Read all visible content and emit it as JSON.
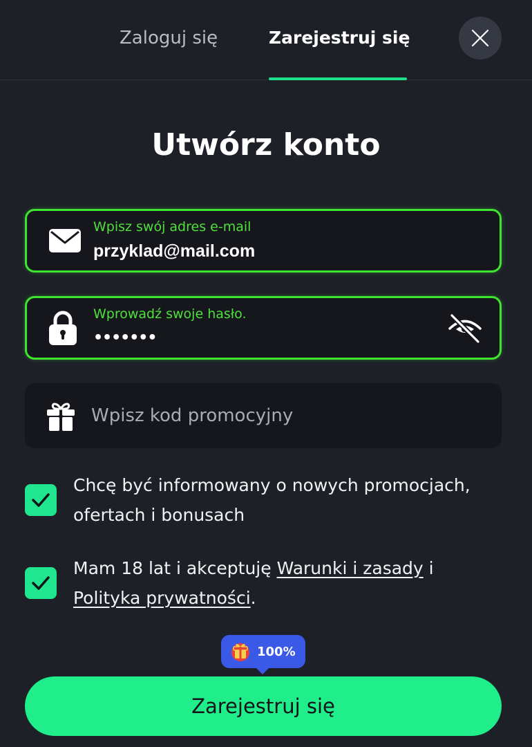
{
  "tabs": {
    "login_label": "Zaloguj się",
    "register_label": "Zarejestruj się",
    "active": "register"
  },
  "title": "Utwórz konto",
  "email": {
    "label": "Wpisz swój adres e-mail",
    "value": "przyklad@mail.com",
    "icon": "envelope-icon"
  },
  "password": {
    "label": "Wprowadź swoje hasło.",
    "value": "•••••••",
    "icon": "lock-icon",
    "toggle_icon": "eye-off-icon"
  },
  "promo": {
    "placeholder": "Wpisz kod promocyjny",
    "icon": "gift-icon"
  },
  "consents": {
    "newsletter_text": "Chcę być informowany o nowych promocjach, ofertach i bonusach",
    "newsletter_checked": true,
    "terms_prefix": "Mam 18 lat i akceptuję ",
    "terms_link": "Warunki i zasady",
    "terms_middle": " i ",
    "privacy_link": "Polityka prywatności",
    "terms_suffix": ".",
    "terms_checked": true
  },
  "bonus_badge": {
    "text": "100%",
    "icon": "gift-box-icon"
  },
  "submit_label": "Zarejestruj się",
  "colors": {
    "accent_green": "#1fee8b",
    "field_border_green": "#3ee52e",
    "badge_blue": "#3a59e6",
    "background": "#1e2028"
  }
}
